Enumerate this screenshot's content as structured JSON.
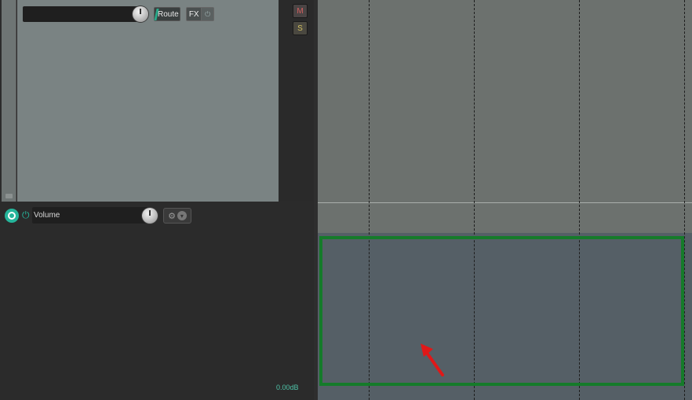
{
  "track": {
    "name": "",
    "route_label": "Route",
    "fx_label": "FX",
    "fx_power_icon": "⏻",
    "mute_label": "M",
    "solo_label": "S"
  },
  "envelope": {
    "name": "Volume",
    "power_icon": "⏻",
    "settings_icon": "⚙",
    "dropdown_icon": "▾",
    "value_display": "0.00dB"
  },
  "colors": {
    "accent": "#25b59b",
    "highlight_border": "#157b2a",
    "pointer": "#e01818",
    "envelope_lane": "#555f66",
    "track_lane": "#6c716e"
  }
}
